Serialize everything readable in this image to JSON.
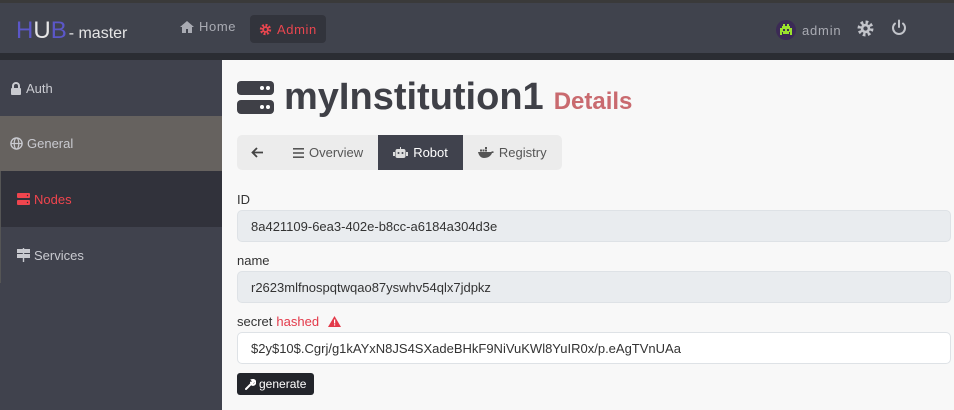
{
  "navbar": {
    "brand": {
      "h": "H",
      "u": "U",
      "b": "B",
      "suffix": "- master"
    },
    "home": "Home",
    "admin": "Admin",
    "user": "admin"
  },
  "sidebar": {
    "items": [
      {
        "label": "Auth"
      },
      {
        "label": "General"
      },
      {
        "label": "Nodes"
      },
      {
        "label": "Services"
      }
    ]
  },
  "page": {
    "title": "myInstitution1",
    "subtitle": "Details"
  },
  "tabs": [
    {
      "label": "Overview"
    },
    {
      "label": "Robot"
    },
    {
      "label": "Registry"
    }
  ],
  "form": {
    "id_label": "ID",
    "id_value": "8a421109-6ea3-402e-b8cc-a6184a304d3e",
    "name_label": "name",
    "name_value": "r2623mlfnospqtwqao87yswhv54qlx7jdpkz",
    "secret_label": "secret",
    "secret_badge": "hashed",
    "secret_value": "$2y$10$.Cgrj/g1kAYxN8JS4SXadeBHkF9NiVuKWl8YuIR0x/p.eAgTVnUAa",
    "generate": "generate"
  },
  "colors": {
    "accent": "#e8464f",
    "brand": "#5b57c8",
    "navbar": "#40434d"
  }
}
